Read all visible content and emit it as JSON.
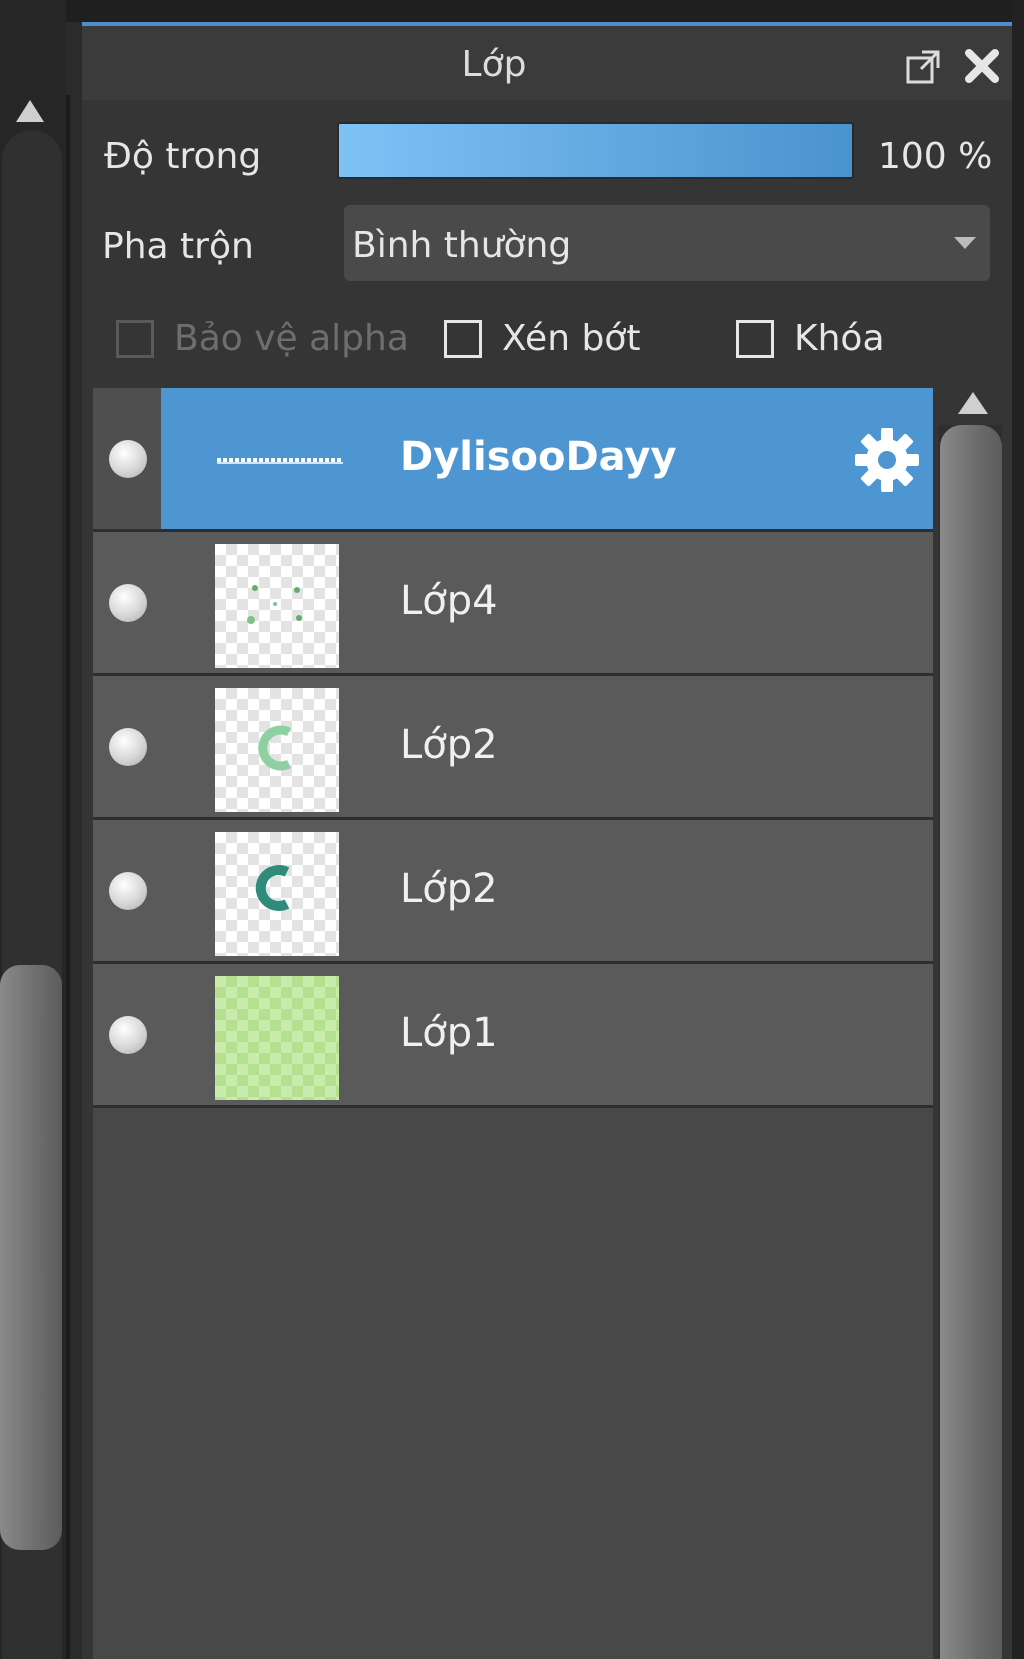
{
  "panel": {
    "title": "Lớp"
  },
  "opacity": {
    "label": "Độ trong",
    "value": "100 %",
    "fraction": 1.0
  },
  "blend": {
    "label": "Pha trộn",
    "value": "Bình thường"
  },
  "options": {
    "protect_alpha": "Bảo vệ alpha",
    "clip": "Xén bớt",
    "lock": "Khóa"
  },
  "layers": [
    {
      "name": "DylisooDayy",
      "selected": true,
      "type": "text"
    },
    {
      "name": "Lớp4",
      "selected": false,
      "type": "image"
    },
    {
      "name": "Lớp2",
      "selected": false,
      "type": "image"
    },
    {
      "name": "Lớp2",
      "selected": false,
      "type": "image"
    },
    {
      "name": "Lớp1",
      "selected": false,
      "type": "image"
    }
  ],
  "colors": {
    "accent": "#4d96d2",
    "panel": "#353535",
    "row": "#5a5a5a"
  }
}
